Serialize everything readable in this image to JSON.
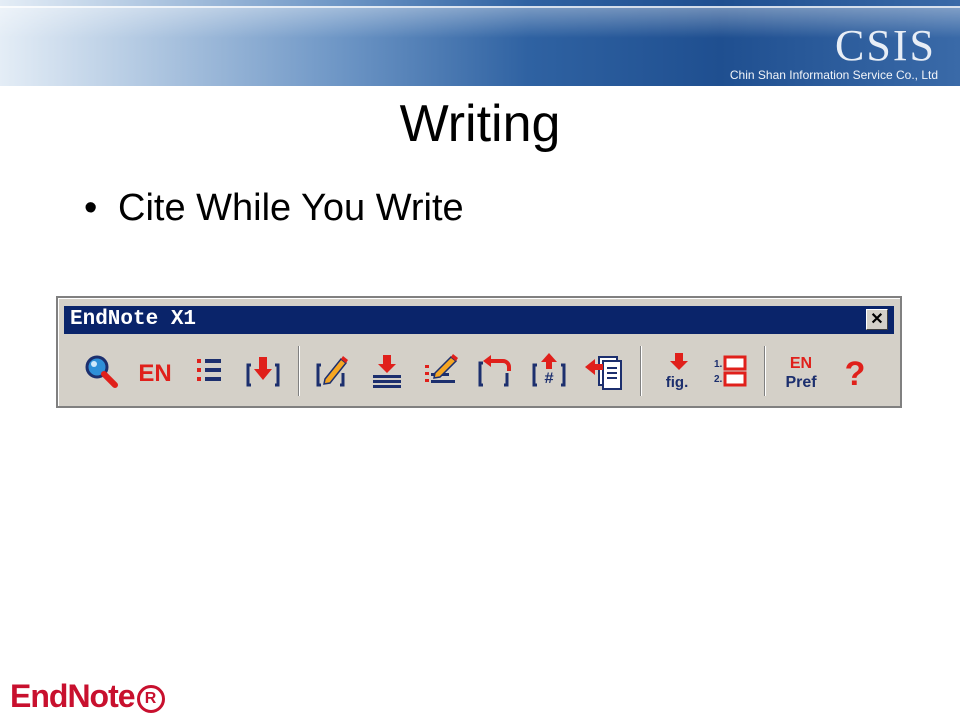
{
  "banner": {
    "logo": "CSIS",
    "company": "Chin Shan Information Service Co., Ltd"
  },
  "slide": {
    "title": "Writing",
    "bullets": [
      "Cite While You Write"
    ]
  },
  "toolbar": {
    "window_title": "EndNote X1",
    "close_glyph": "✕",
    "en_label": "EN",
    "fig_label": "fig.",
    "pref_label_top": "EN",
    "pref_label_bottom": "Pref",
    "help_glyph": "?",
    "buttons": [
      {
        "icon": "find-citation-icon"
      },
      {
        "icon": "go-to-endnote-icon"
      },
      {
        "icon": "format-bibliography-icon"
      },
      {
        "icon": "insert-selected-citation-icon"
      },
      {
        "icon": "edit-citation-icon"
      },
      {
        "icon": "insert-note-icon"
      },
      {
        "icon": "edit-library-reference-icon"
      },
      {
        "icon": "unformat-citations-icon"
      },
      {
        "icon": "remove-field-codes-icon"
      },
      {
        "icon": "export-traveling-library-icon"
      },
      {
        "icon": "insert-figure-icon"
      },
      {
        "icon": "generate-figure-list-icon"
      },
      {
        "icon": "preferences-icon"
      },
      {
        "icon": "help-icon"
      }
    ]
  },
  "footer": {
    "logo_text": "EndNote",
    "registered_mark": "R"
  },
  "colors": {
    "titlebar": "#0a246a",
    "toolbar_bg": "#d4d0c8",
    "icon_red": "#e0201b",
    "icon_navy": "#1c2f6e",
    "logo_red": "#c8102e"
  }
}
